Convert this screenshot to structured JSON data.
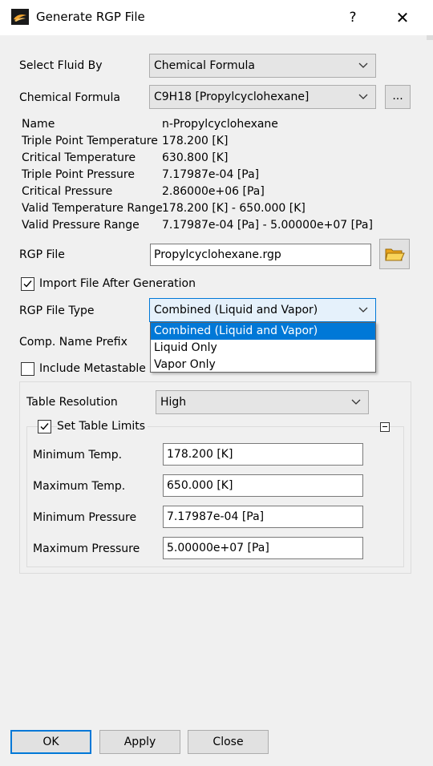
{
  "window": {
    "title": "Generate RGP File",
    "help_label": "?",
    "close_label": "✕"
  },
  "select_fluid_by": {
    "label": "Select Fluid By",
    "value": "Chemical Formula"
  },
  "chemical_formula": {
    "label": "Chemical Formula",
    "value": "C9H18 [Propylcyclohexane]",
    "browse_label": "..."
  },
  "properties": [
    {
      "label": "Name",
      "value": "n-Propylcyclohexane"
    },
    {
      "label": "Triple Point Temperature",
      "value": "178.200 [K]"
    },
    {
      "label": "Critical Temperature",
      "value": "630.800 [K]"
    },
    {
      "label": "Triple Point Pressure",
      "value": "7.17987e-04 [Pa]"
    },
    {
      "label": "Critical Pressure",
      "value": "2.86000e+06 [Pa]"
    },
    {
      "label": "Valid Temperature Range",
      "value": "178.200 [K] - 650.000 [K]"
    },
    {
      "label": "Valid Pressure Range",
      "value": "7.17987e-04 [Pa] - 5.00000e+07 [Pa]"
    }
  ],
  "rgp_file": {
    "label": "RGP File",
    "value": "Propylcyclohexane.rgp",
    "folder_icon": "open-folder-icon"
  },
  "import_after": {
    "label": "Import File After Generation",
    "checked": true
  },
  "rgp_file_type": {
    "label": "RGP File Type",
    "value": "Combined (Liquid and Vapor)",
    "options": [
      "Combined (Liquid and Vapor)",
      "Liquid Only",
      "Vapor Only"
    ]
  },
  "comp_name_prefix": {
    "label": "Comp. Name Prefix"
  },
  "include_metastable": {
    "label": "Include Metastable S",
    "checked": false
  },
  "table_resolution": {
    "label": "Table Resolution",
    "value": "High"
  },
  "set_table_limits": {
    "label": "Set Table Limits",
    "checked": true
  },
  "limits": [
    {
      "label": "Minimum Temp.",
      "value": "178.200 [K]"
    },
    {
      "label": "Maximum Temp.",
      "value": "650.000 [K]"
    },
    {
      "label": "Minimum Pressure",
      "value": "7.17987e-04 [Pa]"
    },
    {
      "label": "Maximum Pressure",
      "value": "5.00000e+07 [Pa]"
    }
  ],
  "buttons": {
    "ok": "OK",
    "apply": "Apply",
    "close": "Close"
  },
  "colors": {
    "accent": "#0078d7",
    "background": "#f0f0f0"
  }
}
